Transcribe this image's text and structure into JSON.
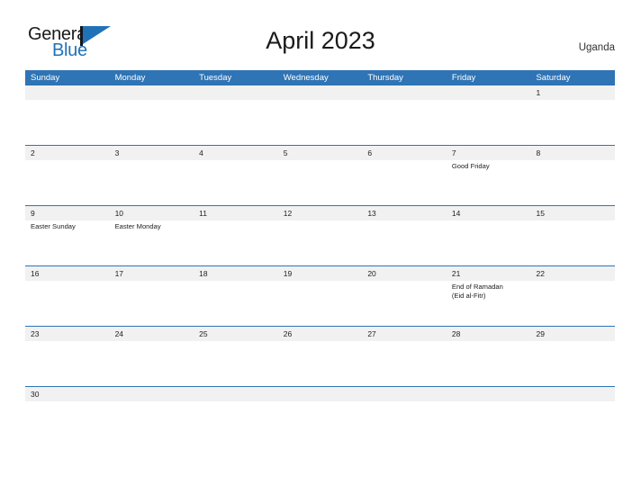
{
  "brand": {
    "name_part1": "General",
    "name_part2": "Blue",
    "flag_color": "#2072b8",
    "pole_color": "#14171c"
  },
  "header": {
    "title": "April 2023",
    "country": "Uganda"
  },
  "colors": {
    "header_blue": "#2f74b5",
    "band_gray": "#f1f1f1",
    "rule_blue": "#2f74b5",
    "text": "#222222"
  },
  "calendar": {
    "day_names": [
      "Sunday",
      "Monday",
      "Tuesday",
      "Wednesday",
      "Thursday",
      "Friday",
      "Saturday"
    ],
    "weeks": [
      {
        "days": [
          {
            "date": "",
            "events": []
          },
          {
            "date": "",
            "events": []
          },
          {
            "date": "",
            "events": []
          },
          {
            "date": "",
            "events": []
          },
          {
            "date": "",
            "events": []
          },
          {
            "date": "",
            "events": []
          },
          {
            "date": "1",
            "events": []
          }
        ]
      },
      {
        "days": [
          {
            "date": "2",
            "events": []
          },
          {
            "date": "3",
            "events": []
          },
          {
            "date": "4",
            "events": []
          },
          {
            "date": "5",
            "events": []
          },
          {
            "date": "6",
            "events": []
          },
          {
            "date": "7",
            "events": [
              "Good Friday"
            ]
          },
          {
            "date": "8",
            "events": []
          }
        ]
      },
      {
        "days": [
          {
            "date": "9",
            "events": [
              "Easter Sunday"
            ]
          },
          {
            "date": "10",
            "events": [
              "Easter Monday"
            ]
          },
          {
            "date": "11",
            "events": []
          },
          {
            "date": "12",
            "events": []
          },
          {
            "date": "13",
            "events": []
          },
          {
            "date": "14",
            "events": []
          },
          {
            "date": "15",
            "events": []
          }
        ]
      },
      {
        "days": [
          {
            "date": "16",
            "events": []
          },
          {
            "date": "17",
            "events": []
          },
          {
            "date": "18",
            "events": []
          },
          {
            "date": "19",
            "events": []
          },
          {
            "date": "20",
            "events": []
          },
          {
            "date": "21",
            "events": [
              "End of Ramadan",
              "(Eid al-Fitr)"
            ]
          },
          {
            "date": "22",
            "events": []
          }
        ]
      },
      {
        "days": [
          {
            "date": "23",
            "events": []
          },
          {
            "date": "24",
            "events": []
          },
          {
            "date": "25",
            "events": []
          },
          {
            "date": "26",
            "events": []
          },
          {
            "date": "27",
            "events": []
          },
          {
            "date": "28",
            "events": []
          },
          {
            "date": "29",
            "events": []
          }
        ]
      },
      {
        "last": true,
        "days": [
          {
            "date": "30",
            "events": []
          },
          {
            "date": "",
            "events": []
          },
          {
            "date": "",
            "events": []
          },
          {
            "date": "",
            "events": []
          },
          {
            "date": "",
            "events": []
          },
          {
            "date": "",
            "events": []
          },
          {
            "date": "",
            "events": []
          }
        ]
      }
    ]
  }
}
